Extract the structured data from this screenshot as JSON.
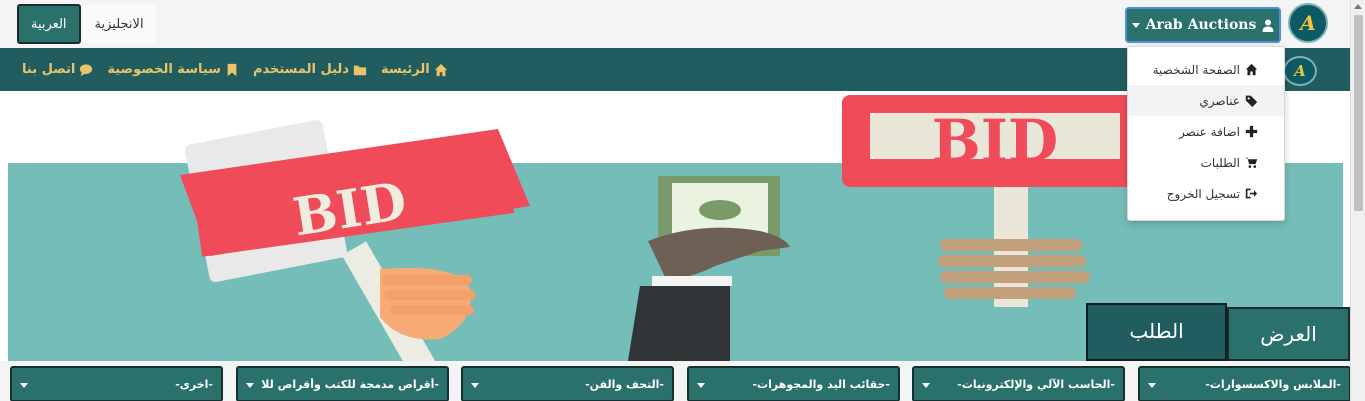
{
  "languages": {
    "arabic": "العربية",
    "english": "الانجليزية"
  },
  "user_menu": {
    "label": "Arab Auctions",
    "icon": "user-icon"
  },
  "logo": {
    "glyph": "A",
    "icon": "arab-auctions-logo"
  },
  "nav": [
    {
      "label": "الرئيسة",
      "icon": "home-icon"
    },
    {
      "label": "دليل المستخدم",
      "icon": "folder-icon"
    },
    {
      "label": "سياسة الخصوصية",
      "icon": "bookmark-icon"
    },
    {
      "label": "اتصل بنا",
      "icon": "comment-icon"
    }
  ],
  "dropdown": [
    {
      "label": "الصفحة الشخصية",
      "icon": "home-icon"
    },
    {
      "label": "عناصري",
      "icon": "tags-icon"
    },
    {
      "label": "اضافة عنصر",
      "icon": "plus-icon"
    },
    {
      "label": "الطلبات",
      "icon": "cart-icon"
    },
    {
      "label": "تسجيل الخروج",
      "icon": "sign-out-icon"
    }
  ],
  "hero": {
    "sign_text_1": "BID",
    "sign_text_2": "BID"
  },
  "tabs": {
    "offer": "العرض",
    "request": "الطلب"
  },
  "categories": [
    "-الملابس والاكسسوارات-",
    "-الحاسب الآلي والإلكترونيات-",
    "-حقائب اليد والمجوهرات-",
    "-التحف والفن-",
    "-أقراص مدمجة للكتب وأقراص للا",
    "-اخرى-"
  ],
  "colors": {
    "teal": "#2a706b",
    "nav": "#215d5f",
    "gold": "#e9c46a",
    "hero_bg": "#75bdb9",
    "sign_red": "#f04b59"
  }
}
